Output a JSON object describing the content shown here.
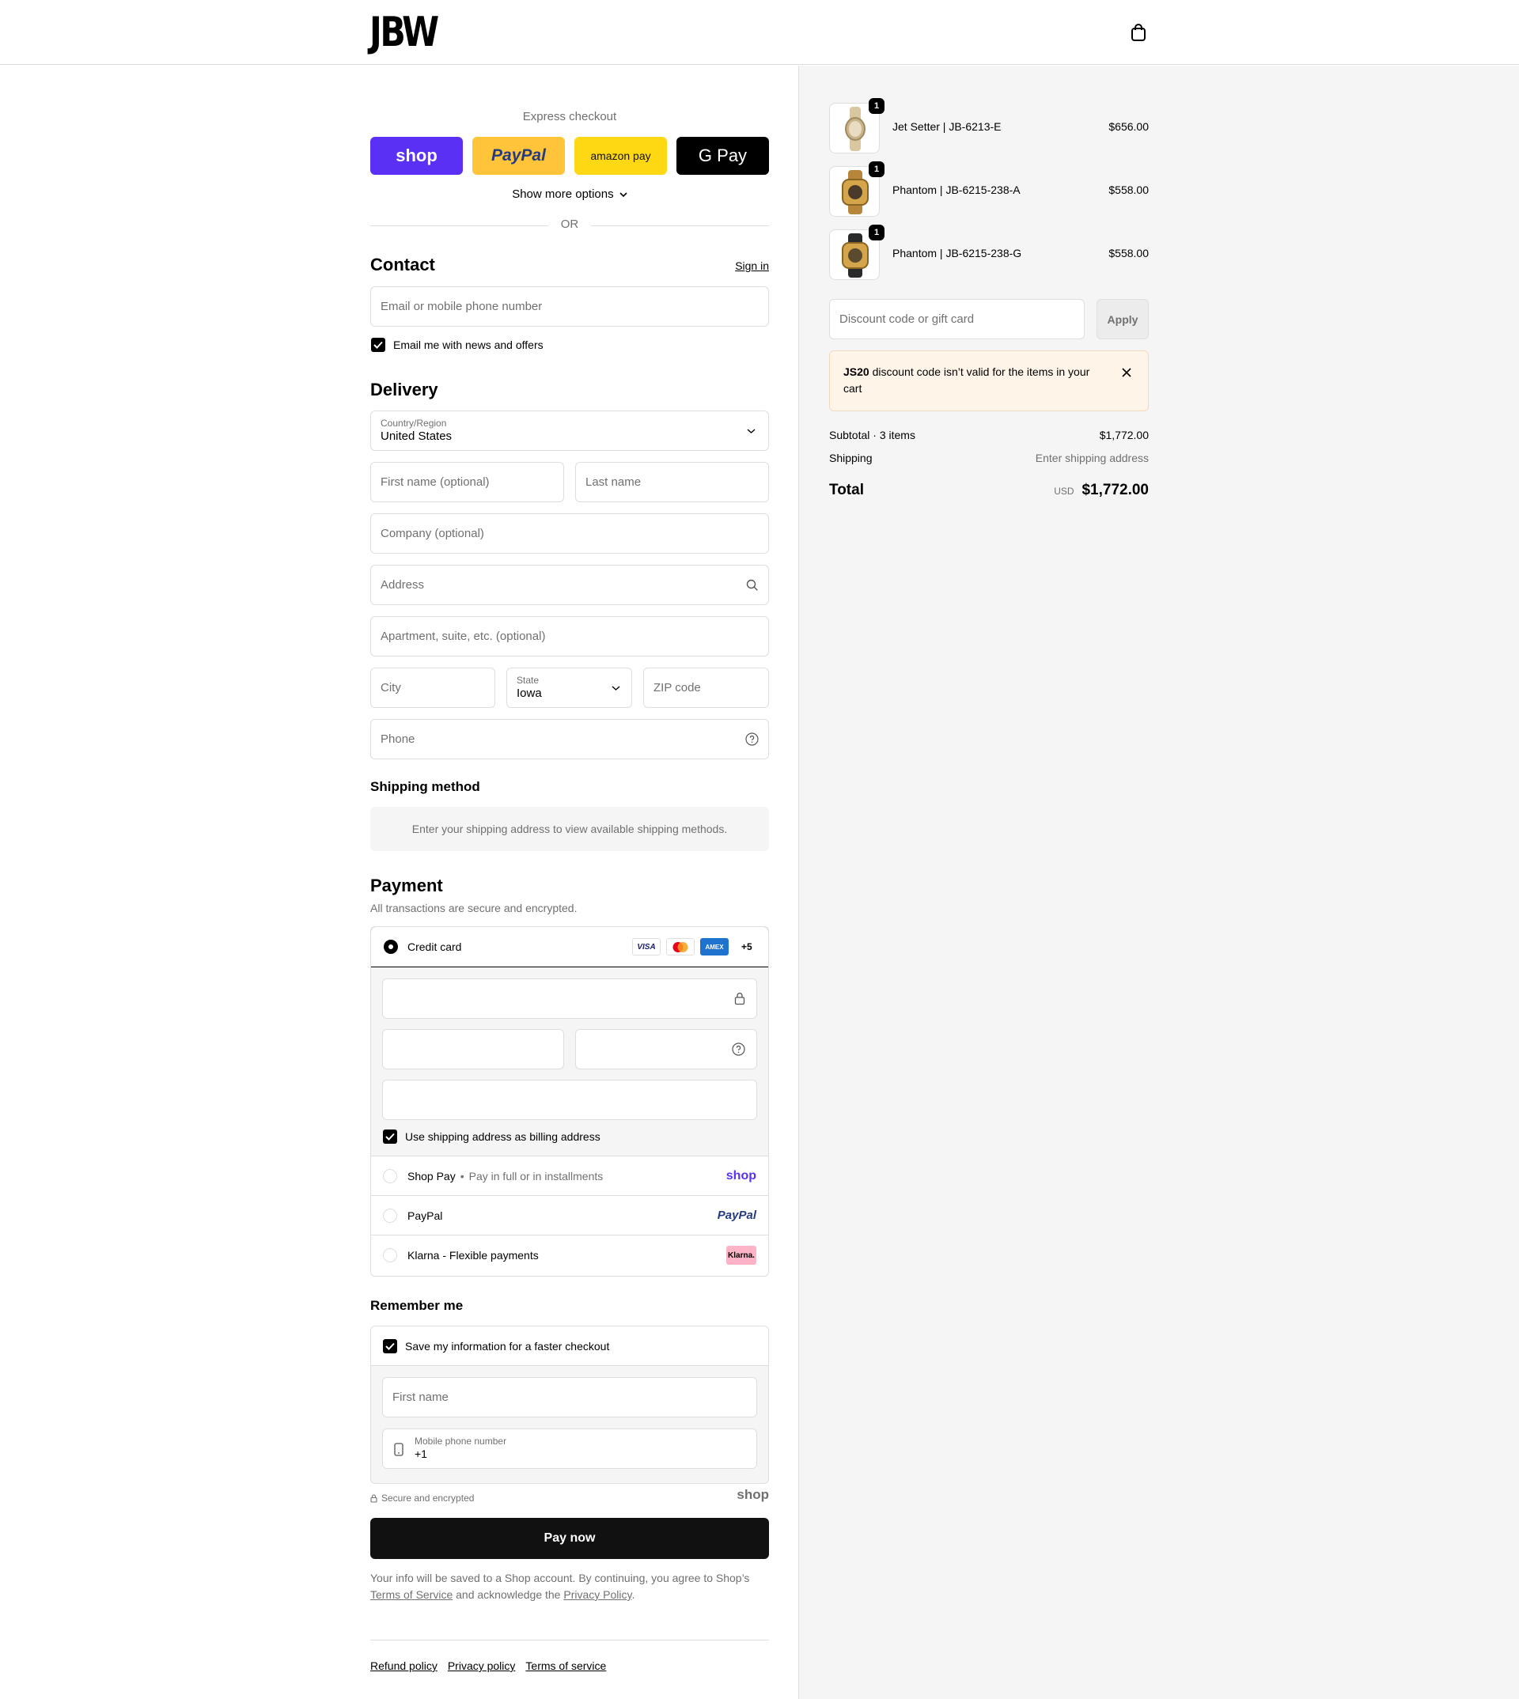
{
  "header": {
    "logo": "JBW",
    "cart_icon": "shopping-bag-icon"
  },
  "express": {
    "title": "Express checkout",
    "buttons": [
      {
        "label": "shop",
        "color": "#5a31f4"
      },
      {
        "label": "PayPal",
        "color": "#ffc439"
      },
      {
        "label": "amazon pay",
        "color": "#ffd814"
      },
      {
        "label": "G Pay",
        "color": "#000000"
      }
    ],
    "show_more": "Show more options",
    "or": "OR"
  },
  "contact": {
    "title": "Contact",
    "sign_in": "Sign in",
    "email_placeholder": "Email or mobile phone number",
    "news_checkbox": "Email me with news and offers"
  },
  "delivery": {
    "title": "Delivery",
    "country_label": "Country/Region",
    "country_value": "United States",
    "first_name_placeholder": "First name (optional)",
    "last_name_placeholder": "Last name",
    "company_placeholder": "Company (optional)",
    "address_placeholder": "Address",
    "apartment_placeholder": "Apartment, suite, etc. (optional)",
    "city_placeholder": "City",
    "state_label": "State",
    "state_value": "Iowa",
    "zip_placeholder": "ZIP code",
    "phone_placeholder": "Phone"
  },
  "shipping": {
    "title": "Shipping method",
    "message": "Enter your shipping address to view available shipping methods."
  },
  "payment": {
    "title": "Payment",
    "subtitle": "All transactions are secure and encrypted.",
    "credit_card": "Credit card",
    "card_brands": [
      "VISA",
      "MC",
      "AMEX"
    ],
    "more_brands": "+5",
    "billing_checkbox": "Use shipping address as billing address",
    "shop_pay": "Shop Pay",
    "shop_pay_sub": "Pay in full or in installments",
    "shop_logo": "shop",
    "paypal": "PayPal",
    "paypal_logo": "PayPal",
    "klarna": "Klarna - Flexible payments",
    "klarna_logo": "Klarna."
  },
  "remember": {
    "title": "Remember me",
    "save_checkbox": "Save my information for a faster checkout",
    "first_name_placeholder": "First name",
    "mobile_label": "Mobile phone number",
    "mobile_value": "+1",
    "secure": "Secure and encrypted",
    "shop_logo": "shop"
  },
  "pay_now": "Pay now",
  "legal": {
    "text1": "Your info will be saved to a Shop account. By continuing, you agree to Shop’s",
    "tos": "Terms of Service",
    "text2": "and acknowledge the",
    "privacy": "Privacy Policy",
    "end": "."
  },
  "footer": {
    "links": [
      "Refund policy",
      "Privacy policy",
      "Terms of service"
    ]
  },
  "cart": {
    "items": [
      {
        "name": "Jet Setter | JB-6213-E",
        "price": "$656.00",
        "qty": "1"
      },
      {
        "name": "Phantom | JB-6215-238-A",
        "price": "$558.00",
        "qty": "1"
      },
      {
        "name": "Phantom | JB-6215-238-G",
        "price": "$558.00",
        "qty": "1"
      }
    ],
    "discount_placeholder": "Discount code or gift card",
    "apply": "Apply",
    "warning_code": "JS20",
    "warning_text": " discount code isn’t valid for the items in your cart",
    "subtotal_label": "Subtotal · 3 items",
    "subtotal_value": "$1,772.00",
    "shipping_label": "Shipping",
    "shipping_value": "Enter shipping address",
    "total_label": "Total",
    "currency": "USD",
    "total_value": "$1,772.00"
  }
}
